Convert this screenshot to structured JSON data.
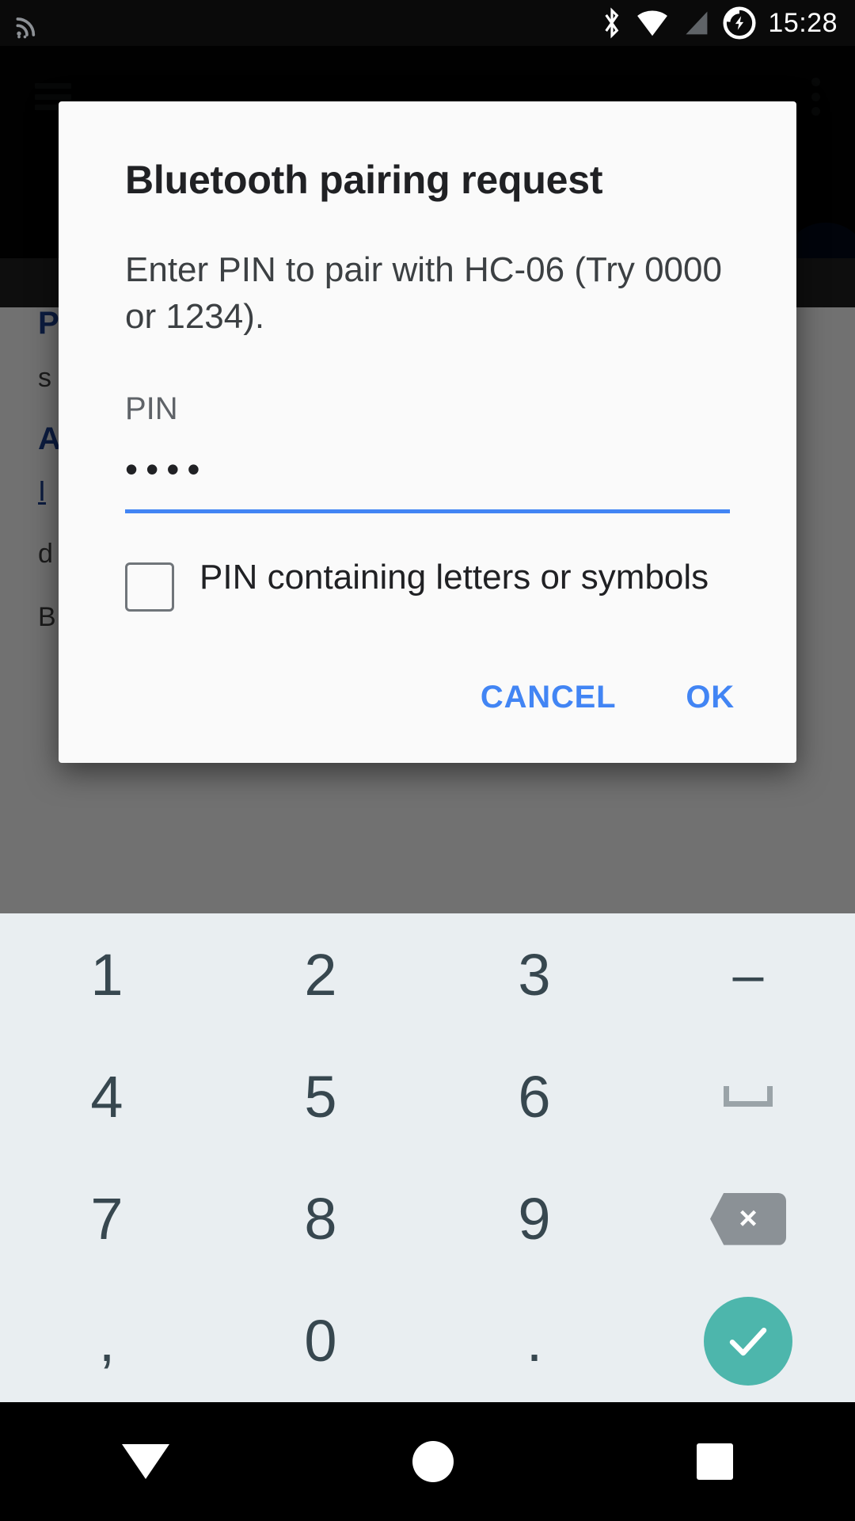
{
  "status_bar": {
    "time": "15:28",
    "icons": [
      "cast-icon",
      "bluetooth-icon",
      "wifi-icon",
      "cellular-signal-icon",
      "battery-charging-icon"
    ]
  },
  "background_app": {
    "menu_icon": "hamburger-menu-icon",
    "overflow_icon": "overflow-menu-icon",
    "fab": "floating-action-button",
    "heading_1": "P",
    "line_1": "s",
    "heading_2": "A",
    "link_1": "I",
    "line_2": "d",
    "line_3": "B"
  },
  "dialog": {
    "title": "Bluetooth pairing request",
    "message": "Enter PIN to pair with HC-06 (Try 0000 or 1234).",
    "pin_label": "PIN",
    "pin_value": "••••",
    "pin_placeholder": "PIN",
    "checkbox_label": "PIN containing letters or symbols",
    "checkbox_checked": false,
    "cancel_label": "CANCEL",
    "ok_label": "OK",
    "accent_color": "#4285f4"
  },
  "keypad": {
    "rows": [
      [
        {
          "label": "1",
          "name": "key-1",
          "type": "digit"
        },
        {
          "label": "2",
          "name": "key-2",
          "type": "digit"
        },
        {
          "label": "3",
          "name": "key-3",
          "type": "digit"
        },
        {
          "label": "–",
          "name": "key-dash",
          "type": "symbol"
        }
      ],
      [
        {
          "label": "4",
          "name": "key-4",
          "type": "digit"
        },
        {
          "label": "5",
          "name": "key-5",
          "type": "digit"
        },
        {
          "label": "6",
          "name": "key-6",
          "type": "digit"
        },
        {
          "label": "",
          "name": "key-space",
          "type": "space"
        }
      ],
      [
        {
          "label": "7",
          "name": "key-7",
          "type": "digit"
        },
        {
          "label": "8",
          "name": "key-8",
          "type": "digit"
        },
        {
          "label": "9",
          "name": "key-9",
          "type": "digit"
        },
        {
          "label": "×",
          "name": "key-backspace",
          "type": "backspace"
        }
      ],
      [
        {
          "label": ",",
          "name": "key-comma",
          "type": "symbol"
        },
        {
          "label": "0",
          "name": "key-0",
          "type": "digit"
        },
        {
          "label": ".",
          "name": "key-period",
          "type": "symbol"
        },
        {
          "label": "",
          "name": "key-enter",
          "type": "enter"
        }
      ]
    ],
    "background_color": "#e9eef1",
    "key_color": "#37474f",
    "enter_color": "#4db6ac",
    "backspace_color": "#8b9196"
  },
  "nav_bar": {
    "back_icon": "back-triangle-icon",
    "home_icon": "home-circle-icon",
    "recents_icon": "recents-square-icon"
  }
}
